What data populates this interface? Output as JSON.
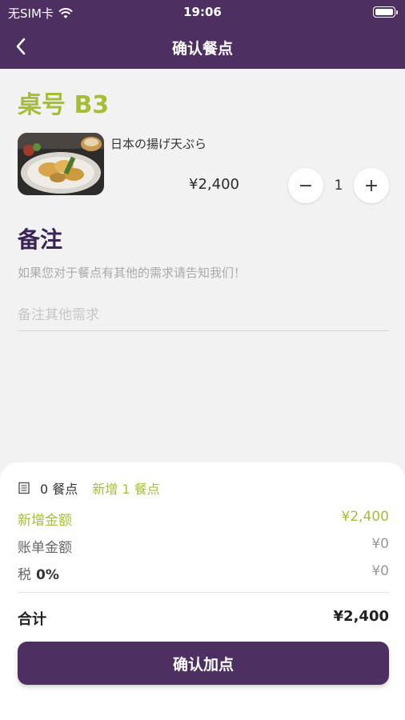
{
  "status_bar": {
    "carrier": "无SIM卡",
    "time": "19:06"
  },
  "nav": {
    "title": "确认餐点"
  },
  "table": {
    "label": "桌号 B3"
  },
  "order_item": {
    "name": "日本の揚げ天ぷら",
    "price": "¥2,400",
    "quantity": "1",
    "minus": "−",
    "plus": "+"
  },
  "remark": {
    "title": "备注",
    "hint": "如果您对于餐点有其他的需求请告知我们！",
    "placeholder": "备注其他需求",
    "value": ""
  },
  "summary": {
    "count": "0 餐点",
    "new_count": "新增 1 餐点",
    "added_label": "新增金额",
    "added_value": "¥2,400",
    "bill_label": "账单金额",
    "bill_value": "¥0",
    "tax_label": "税",
    "tax_rate": "0%",
    "tax_value": "¥0",
    "total_label": "合计",
    "total_value": "¥2,400"
  },
  "confirm_button": "确认加点",
  "colors": {
    "primary": "#4e2f62",
    "accent": "#a5bf34"
  }
}
